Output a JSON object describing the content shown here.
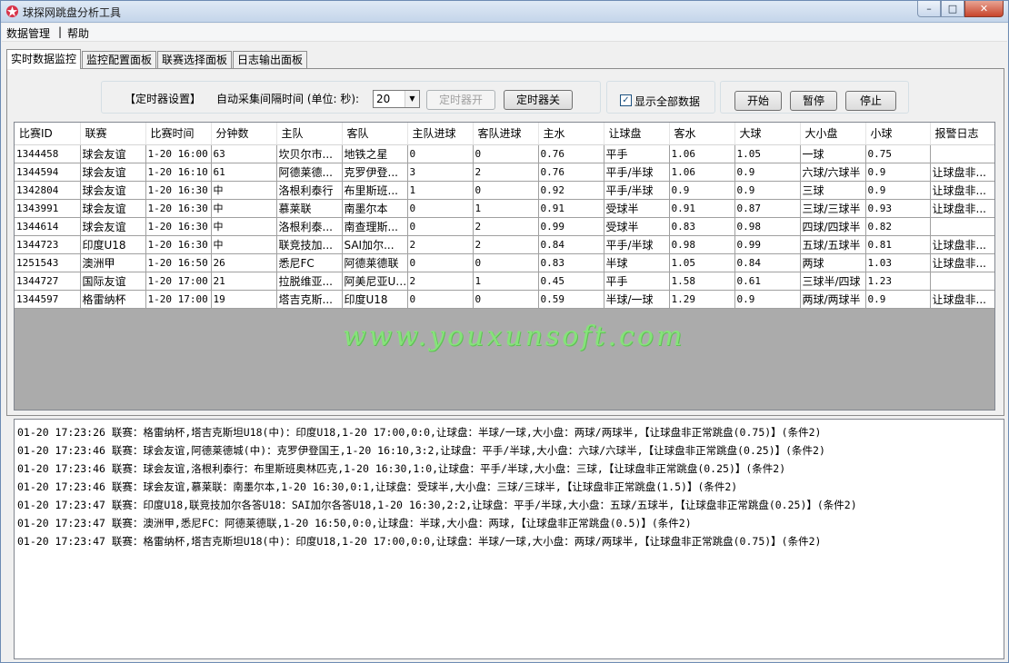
{
  "window": {
    "title": "球探网跳盘分析工具",
    "controls": [
      "–",
      "□",
      "✕"
    ]
  },
  "menu": {
    "items": [
      "数据管理",
      "帮助"
    ],
    "separator": "|"
  },
  "tabs": [
    "实时数据监控",
    "监控配置面板",
    "联赛选择面板",
    "日志输出面板"
  ],
  "timer": {
    "section_label": "【定时器设置】",
    "interval_label": "自动采集间隔时间 (单位: 秒):",
    "interval_value": "20",
    "start_label": "定时器开",
    "stop_label": "定时器关"
  },
  "options": {
    "show_all_label": "显示全部数据",
    "show_all_checked": true
  },
  "controls": {
    "start": "开始",
    "pause": "暂停",
    "stop": "停止"
  },
  "table": {
    "columns": [
      "比赛ID",
      "联赛",
      "比赛时间",
      "分钟数",
      "主队",
      "客队",
      "主队进球",
      "客队进球",
      "主水",
      "让球盘",
      "客水",
      "大球",
      "大小盘",
      "小球",
      "报警日志"
    ],
    "rows": [
      [
        "1344458",
        "球会友谊",
        "1-20 16:00",
        "63",
        "坎贝尔市...",
        "地铁之星",
        "0",
        "0",
        "0.76",
        "平手",
        "1.06",
        "1.05",
        "一球",
        "0.75",
        ""
      ],
      [
        "1344594",
        "球会友谊",
        "1-20 16:10",
        "61",
        "阿德莱德...",
        "克罗伊登...",
        "3",
        "2",
        "0.76",
        "平手/半球",
        "1.06",
        "0.9",
        "六球/六球半",
        "0.9",
        "让球盘非..."
      ],
      [
        "1342804",
        "球会友谊",
        "1-20 16:30",
        "中",
        "洛根利泰行",
        "布里斯班...",
        "1",
        "0",
        "0.92",
        "平手/半球",
        "0.9",
        "0.9",
        "三球",
        "0.9",
        "让球盘非..."
      ],
      [
        "1343991",
        "球会友谊",
        "1-20 16:30",
        "中",
        "慕莱联",
        "南墨尔本",
        "0",
        "1",
        "0.91",
        "受球半",
        "0.91",
        "0.87",
        "三球/三球半",
        "0.93",
        "让球盘非..."
      ],
      [
        "1344614",
        "球会友谊",
        "1-20 16:30",
        "中",
        "洛根利泰...",
        "南查理斯...",
        "0",
        "2",
        "0.99",
        "受球半",
        "0.83",
        "0.98",
        "四球/四球半",
        "0.82",
        ""
      ],
      [
        "1344723",
        "印度U18",
        "1-20 16:30",
        "中",
        "联竞技加...",
        "SAI加尔...",
        "2",
        "2",
        "0.84",
        "平手/半球",
        "0.98",
        "0.99",
        "五球/五球半",
        "0.81",
        "让球盘非..."
      ],
      [
        "1251543",
        "澳洲甲",
        "1-20 16:50",
        "26",
        "悉尼FC",
        "阿德莱德联",
        "0",
        "0",
        "0.83",
        "半球",
        "1.05",
        "0.84",
        "两球",
        "1.03",
        "让球盘非..."
      ],
      [
        "1344727",
        "国际友谊",
        "1-20 17:00",
        "21",
        "拉脱维亚...",
        "阿美尼亚U17",
        "2",
        "1",
        "0.45",
        "平手",
        "1.58",
        "0.61",
        "三球半/四球",
        "1.23",
        ""
      ],
      [
        "1344597",
        "格雷纳杯",
        "1-20 17:00",
        "19",
        "塔吉克斯...",
        "印度U18",
        "0",
        "0",
        "0.59",
        "半球/一球",
        "1.29",
        "0.9",
        "两球/两球半",
        "0.9",
        "让球盘非..."
      ]
    ]
  },
  "watermark": "www.youxunsoft.com",
  "log": [
    "01-20 17:23:26 联赛：格雷纳杯,塔吉克斯坦U18(中)：印度U18,1-20 17:00,0:0,让球盘：半球/一球,大小盘：两球/两球半,【让球盘非正常跳盘(0.75)】(条件2)",
    "01-20 17:23:46 联赛：球会友谊,阿德莱德城(中)：克罗伊登国王,1-20 16:10,3:2,让球盘：平手/半球,大小盘：六球/六球半,【让球盘非正常跳盘(0.25)】(条件2)",
    "01-20 17:23:46 联赛：球会友谊,洛根利泰行：布里斯班奥林匹克,1-20 16:30,1:0,让球盘：平手/半球,大小盘：三球,【让球盘非正常跳盘(0.25)】(条件2)",
    "01-20 17:23:46 联赛：球会友谊,慕莱联：南墨尔本,1-20 16:30,0:1,让球盘：受球半,大小盘：三球/三球半,【让球盘非正常跳盘(1.5)】(条件2)",
    "01-20 17:23:47 联赛：印度U18,联竞技加尔各答U18：SAI加尔各答U18,1-20 16:30,2:2,让球盘：平手/半球,大小盘：五球/五球半,【让球盘非正常跳盘(0.25)】(条件2)",
    "01-20 17:23:47 联赛：澳洲甲,悉尼FC：阿德莱德联,1-20 16:50,0:0,让球盘：半球,大小盘：两球,【让球盘非正常跳盘(0.5)】(条件2)",
    "01-20 17:23:47 联赛：格雷纳杯,塔吉克斯坦U18(中)：印度U18,1-20 17:00,0:0,让球盘：半球/一球,大小盘：两球/两球半,【让球盘非正常跳盘(0.75)】(条件2)"
  ]
}
